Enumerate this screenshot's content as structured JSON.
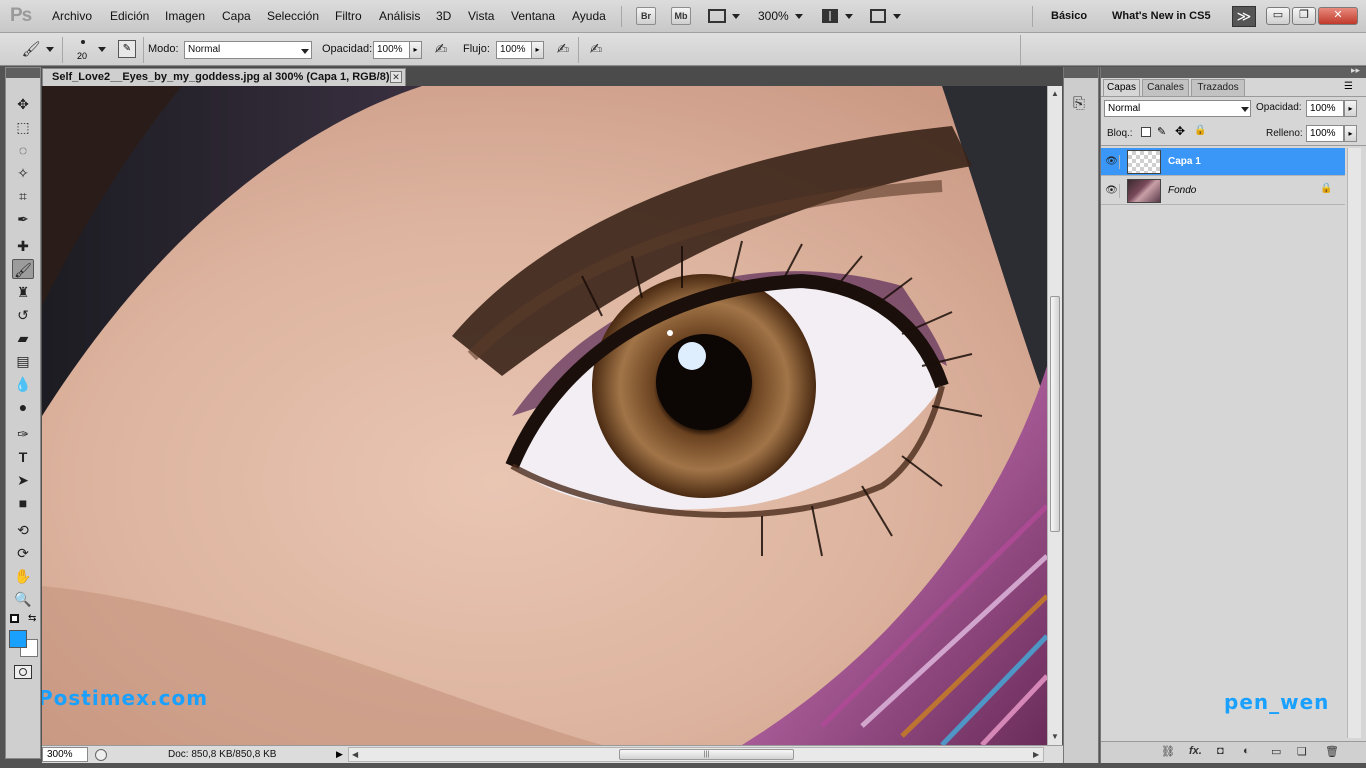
{
  "app": {
    "logo": "Ps"
  },
  "menu": [
    "Archivo",
    "Edición",
    "Imagen",
    "Capa",
    "Selección",
    "Filtro",
    "Análisis",
    "3D",
    "Vista",
    "Ventana",
    "Ayuda"
  ],
  "menubar": {
    "bridge_btn": "Br",
    "minibridge_btn": "Mb",
    "zoom": "300%",
    "workspace_basic": "Básico",
    "workspace_new": "What's New in CS5",
    "more_glyph": "≫",
    "minimize": "▭",
    "restore": "❐",
    "close": "✕"
  },
  "options": {
    "brush_size": "20",
    "mode_label": "Modo:",
    "mode_value": "Normal",
    "opacity_label": "Opacidad:",
    "opacity_value": "100%",
    "flow_label": "Flujo:",
    "flow_value": "100%"
  },
  "document": {
    "tab_title": "Self_Love2__Eyes_by_my_goddess.jpg al 300% (Capa 1, RGB/8) *",
    "close_glyph": "✕",
    "status_zoom": "300%",
    "status_doc": "Doc: 850,8 KB/850,8 KB"
  },
  "colors": {
    "accent": "#3a97f7",
    "foreground": "#1aa0ff",
    "background": "#ffffff",
    "watermark": "#1aa0ff"
  },
  "tools": [
    "move-icon",
    "marquee-icon",
    "lasso-icon",
    "quick-select-icon",
    "crop-icon",
    "eyedropper-icon",
    "healing-brush-icon",
    "brush-icon",
    "clone-stamp-icon",
    "history-brush-icon",
    "eraser-icon",
    "gradient-icon",
    "blur-icon",
    "dodge-icon",
    "pen-icon",
    "type-icon",
    "path-select-icon",
    "shape-icon",
    "3d-rotate-icon",
    "3d-orbit-icon",
    "hand-icon",
    "zoom-icon"
  ],
  "layers_panel": {
    "tabs": [
      "Capas",
      "Canales",
      "Trazados"
    ],
    "blend_mode": "Normal",
    "opacity_label": "Opacidad:",
    "opacity_value": "100%",
    "lock_label": "Bloq.:",
    "fill_label": "Relleno:",
    "fill_value": "100%",
    "layers": [
      {
        "name": "Capa 1",
        "selected": true
      },
      {
        "name": "Fondo",
        "selected": false,
        "locked": true
      }
    ]
  },
  "watermarks": {
    "left": "Postimex.com",
    "right": "pen_wen"
  }
}
